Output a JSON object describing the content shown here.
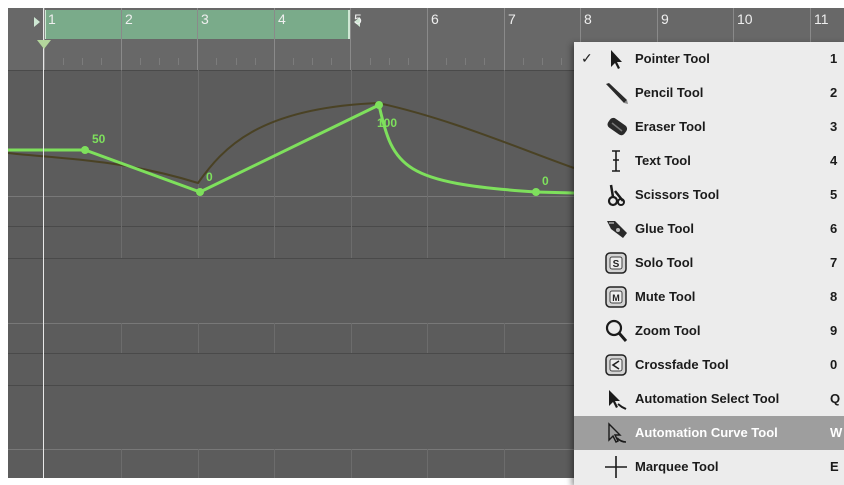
{
  "ruler": {
    "bars": [
      "1",
      "2",
      "3",
      "4",
      "5",
      "6",
      "7",
      "8",
      "9",
      "10",
      "11"
    ]
  },
  "automation": {
    "point_labels": [
      "50",
      "0",
      "100",
      "0"
    ],
    "line_color": "#7ee05c",
    "curve_color": "#4a4224"
  },
  "tool_menu": {
    "checkmark": "✓",
    "items": [
      {
        "label": "Pointer Tool",
        "shortcut": "1",
        "icon": "pointer-icon",
        "checked": true
      },
      {
        "label": "Pencil Tool",
        "shortcut": "2",
        "icon": "pencil-icon"
      },
      {
        "label": "Eraser Tool",
        "shortcut": "3",
        "icon": "eraser-icon"
      },
      {
        "label": "Text Tool",
        "shortcut": "4",
        "icon": "text-cursor-icon"
      },
      {
        "label": "Scissors Tool",
        "shortcut": "5",
        "icon": "scissors-icon"
      },
      {
        "label": "Glue Tool",
        "shortcut": "6",
        "icon": "glue-icon"
      },
      {
        "label": "Solo Tool",
        "shortcut": "7",
        "icon": "solo-icon"
      },
      {
        "label": "Mute Tool",
        "shortcut": "8",
        "icon": "mute-icon"
      },
      {
        "label": "Zoom Tool",
        "shortcut": "9",
        "icon": "zoom-icon"
      },
      {
        "label": "Crossfade Tool",
        "shortcut": "0",
        "icon": "crossfade-icon"
      },
      {
        "label": "Automation Select Tool",
        "shortcut": "Q",
        "icon": "automation-select-icon"
      },
      {
        "label": "Automation Curve Tool",
        "shortcut": "W",
        "icon": "automation-curve-icon",
        "selected": true
      },
      {
        "label": "Marquee Tool",
        "shortcut": "E",
        "icon": "marquee-icon"
      }
    ]
  }
}
